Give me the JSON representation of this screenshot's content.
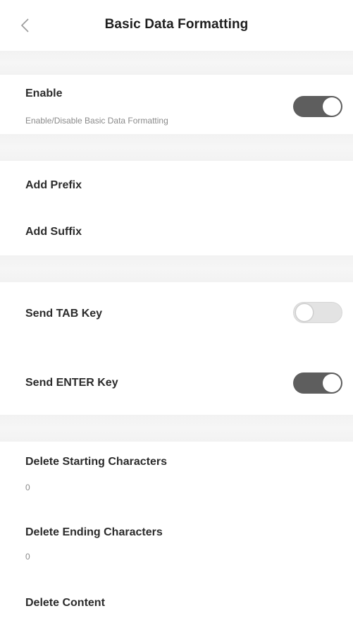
{
  "header": {
    "title": "Basic Data Formatting",
    "back_icon": "chevron-left-icon"
  },
  "settings": {
    "enable": {
      "title": "Enable",
      "subtitle": "Enable/Disable Basic Data Formatting",
      "state": "on"
    },
    "add_prefix": {
      "title": "Add Prefix"
    },
    "add_suffix": {
      "title": "Add Suffix"
    },
    "send_tab": {
      "title": "Send TAB Key",
      "state": "off"
    },
    "send_enter": {
      "title": "Send ENTER Key",
      "state": "on"
    },
    "delete_starting": {
      "title": "Delete Starting Characters",
      "value": "0"
    },
    "delete_ending": {
      "title": "Delete Ending Characters",
      "value": "0"
    },
    "delete_content": {
      "title": "Delete Content"
    }
  },
  "colors": {
    "toggle_on": "#5e5e5e",
    "toggle_off": "#e3e3e3",
    "section_band": "#f3f3f3"
  }
}
